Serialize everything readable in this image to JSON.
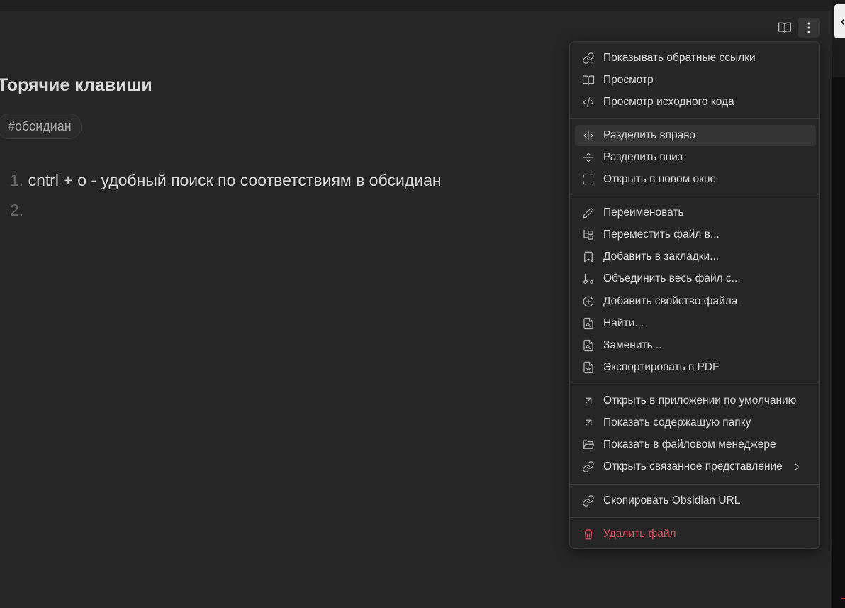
{
  "note": {
    "title": "Торячие клавиши",
    "tag": "#обсидиан",
    "list": [
      {
        "num": "1.",
        "text": "cntrl + o - удобный поиск по соответствиям в обсидиан"
      },
      {
        "num": "2.",
        "text": ""
      }
    ]
  },
  "header": {
    "reading_icon": "book-open-icon",
    "more_icon": "more-vertical-icon"
  },
  "menu": {
    "items": [
      {
        "label": "Показывать обратные ссылки",
        "icon": "link-backlink-icon"
      },
      {
        "label": "Просмотр",
        "icon": "book-open-icon"
      },
      {
        "label": "Просмотр исходного кода",
        "icon": "code-icon"
      },
      {
        "label": "Разделить вправо",
        "icon": "split-vertical-icon"
      },
      {
        "label": "Разделить вниз",
        "icon": "split-horizontal-icon"
      },
      {
        "label": "Открыть в новом окне",
        "icon": "maximize-icon"
      },
      {
        "label": "Переименовать",
        "icon": "pencil-icon"
      },
      {
        "label": "Переместить файл в...",
        "icon": "folder-tree-icon"
      },
      {
        "label": "Добавить в закладки...",
        "icon": "bookmark-icon"
      },
      {
        "label": "Объединить весь файл с...",
        "icon": "git-merge-icon"
      },
      {
        "label": "Добавить свойство файла",
        "icon": "plus-circle-icon"
      },
      {
        "label": "Найти...",
        "icon": "file-search-icon"
      },
      {
        "label": "Заменить...",
        "icon": "file-search-icon"
      },
      {
        "label": "Экспортировать в PDF",
        "icon": "file-download-icon"
      },
      {
        "label": "Открыть в приложении по умолчанию",
        "icon": "arrow-up-right-icon"
      },
      {
        "label": "Показать содержащую папку",
        "icon": "arrow-up-right-icon"
      },
      {
        "label": "Показать в файловом менеджере",
        "icon": "folder-open-icon"
      },
      {
        "label": "Открыть связанное представление",
        "icon": "link-icon"
      },
      {
        "label": "Скопировать Obsidian URL",
        "icon": "link-icon"
      },
      {
        "label": "Удалить файл",
        "icon": "trash-icon"
      }
    ]
  },
  "colors": {
    "background": "#262626",
    "menu_hover": "#353535",
    "danger": "#e04d5f"
  }
}
